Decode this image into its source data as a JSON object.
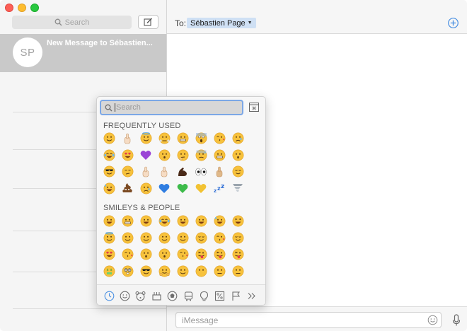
{
  "sidebar": {
    "search_placeholder": "Search",
    "conversation": {
      "avatar_initials": "SP",
      "title": "New Message to Sébastien..."
    }
  },
  "header": {
    "to_label": "To:",
    "recipient": "Sébastien Page"
  },
  "composer": {
    "placeholder": "iMessage"
  },
  "emoji_picker": {
    "search_placeholder": "Search",
    "sections": [
      {
        "title": "FREQUENTLY USED",
        "emojis": [
          {
            "name": "smirking-face",
            "kind": "smile"
          },
          {
            "name": "thumbs-up-light",
            "kind": "hand-light"
          },
          {
            "name": "smiling-face-with-halo",
            "kind": "halo"
          },
          {
            "name": "face-with-steam",
            "kind": "steam"
          },
          {
            "name": "grimacing-face",
            "kind": "grimace"
          },
          {
            "name": "face-screaming-in-fear",
            "kind": "scream"
          },
          {
            "name": "face-throwing-kiss",
            "kind": "kiss"
          },
          {
            "name": "crying-face",
            "kind": "cry"
          },
          {
            "name": "face-with-tears-of-joy",
            "kind": "tearsjoy"
          },
          {
            "name": "heart-eyes",
            "kind": "hearteyes"
          },
          {
            "name": "purple-heart",
            "kind": "heart-purple"
          },
          {
            "name": "hushed-face",
            "kind": "hushed"
          },
          {
            "name": "thinking-face",
            "kind": "think"
          },
          {
            "name": "anxious-face",
            "kind": "anxious"
          },
          {
            "name": "grimacing-face-2",
            "kind": "grimace"
          },
          {
            "name": "hushed-face-2",
            "kind": "hushed"
          },
          {
            "name": "smiling-face-with-sunglasses",
            "kind": "sunglasses"
          },
          {
            "name": "unamused-face",
            "kind": "unamused"
          },
          {
            "name": "sign-of-horns",
            "kind": "hand-light"
          },
          {
            "name": "pointing-up",
            "kind": "hand-light"
          },
          {
            "name": "flexed-biceps",
            "kind": "bicep"
          },
          {
            "name": "eyes",
            "kind": "eyes"
          },
          {
            "name": "thumbs-down",
            "kind": "hand-tan"
          },
          {
            "name": "relieved-face",
            "kind": "relieved"
          },
          {
            "name": "sweat-smile",
            "kind": "sweat"
          },
          {
            "name": "pile-of-poo",
            "kind": "poo"
          },
          {
            "name": "loudly-crying-face",
            "kind": "cry"
          },
          {
            "name": "blue-heart",
            "kind": "heart-blue"
          },
          {
            "name": "green-heart",
            "kind": "heart-green"
          },
          {
            "name": "yellow-heart",
            "kind": "heart-yellow"
          },
          {
            "name": "sleeping-symbol",
            "kind": "zzz"
          },
          {
            "name": "tornado",
            "kind": "tornado"
          }
        ]
      },
      {
        "title": "SMILEYS & PEOPLE",
        "emojis": [
          {
            "name": "grinning-face",
            "kind": "grin"
          },
          {
            "name": "grimacing-face-3",
            "kind": "grimace"
          },
          {
            "name": "grinning-face-with-smiling-eyes",
            "kind": "grin"
          },
          {
            "name": "face-with-tears-of-joy-2",
            "kind": "tearsjoy"
          },
          {
            "name": "smiling-face-with-open-mouth",
            "kind": "grin"
          },
          {
            "name": "smiling-face-with-open-mouth-2",
            "kind": "grin"
          },
          {
            "name": "sweat-smile-2",
            "kind": "sweat"
          },
          {
            "name": "laughing-face",
            "kind": "laugh"
          },
          {
            "name": "smiling-face-with-halo-2",
            "kind": "halo"
          },
          {
            "name": "winking-face",
            "kind": "smile"
          },
          {
            "name": "smiling-face-with-smiling-eyes",
            "kind": "smile"
          },
          {
            "name": "slightly-smiling-face",
            "kind": "smile"
          },
          {
            "name": "upside-down-face",
            "kind": "smile"
          },
          {
            "name": "relaxed-face",
            "kind": "relieved"
          },
          {
            "name": "face-savouring-food",
            "kind": "kiss"
          },
          {
            "name": "relieved-face-2",
            "kind": "relieved"
          },
          {
            "name": "heart-eyes-2",
            "kind": "hearteyes"
          },
          {
            "name": "face-throwing-kiss-2",
            "kind": "kiss"
          },
          {
            "name": "kissing-face",
            "kind": "hushed"
          },
          {
            "name": "kissing-face-with-smiling-eyes",
            "kind": "hushed"
          },
          {
            "name": "kissing-face-with-closed-eyes",
            "kind": "kiss"
          },
          {
            "name": "face-with-tongue-wink",
            "kind": "tongue"
          },
          {
            "name": "face-with-tongue-closed-eyes",
            "kind": "tongue"
          },
          {
            "name": "face-with-stuck-out-tongue",
            "kind": "tongue"
          },
          {
            "name": "money-mouth-face",
            "kind": "money"
          },
          {
            "name": "nerd-face",
            "kind": "nerd"
          },
          {
            "name": "smiling-face-with-sunglasses-2",
            "kind": "sunglasses"
          },
          {
            "name": "hugging-face",
            "kind": "hug"
          },
          {
            "name": "smirking-face-2",
            "kind": "smile"
          },
          {
            "name": "face-without-mouth",
            "kind": "nomouth"
          },
          {
            "name": "neutral-face",
            "kind": "neutral"
          },
          {
            "name": "expressionless-face",
            "kind": "neutral"
          }
        ]
      }
    ],
    "categories": [
      {
        "name": "recent-icon",
        "active": true
      },
      {
        "name": "smileys-icon",
        "active": false
      },
      {
        "name": "animals-icon",
        "active": false
      },
      {
        "name": "food-icon",
        "active": false
      },
      {
        "name": "activity-icon",
        "active": false
      },
      {
        "name": "travel-icon",
        "active": false
      },
      {
        "name": "objects-icon",
        "active": false
      },
      {
        "name": "symbols-icon",
        "active": false
      },
      {
        "name": "flags-icon",
        "active": false
      },
      {
        "name": "more-icon",
        "active": false
      }
    ]
  },
  "colors": {
    "accent": "#4a90e2",
    "emoji_yellow": "#f7c23c",
    "emoji_shade": "#e3a42a",
    "sidebar_selected": "#c9c9c9"
  }
}
